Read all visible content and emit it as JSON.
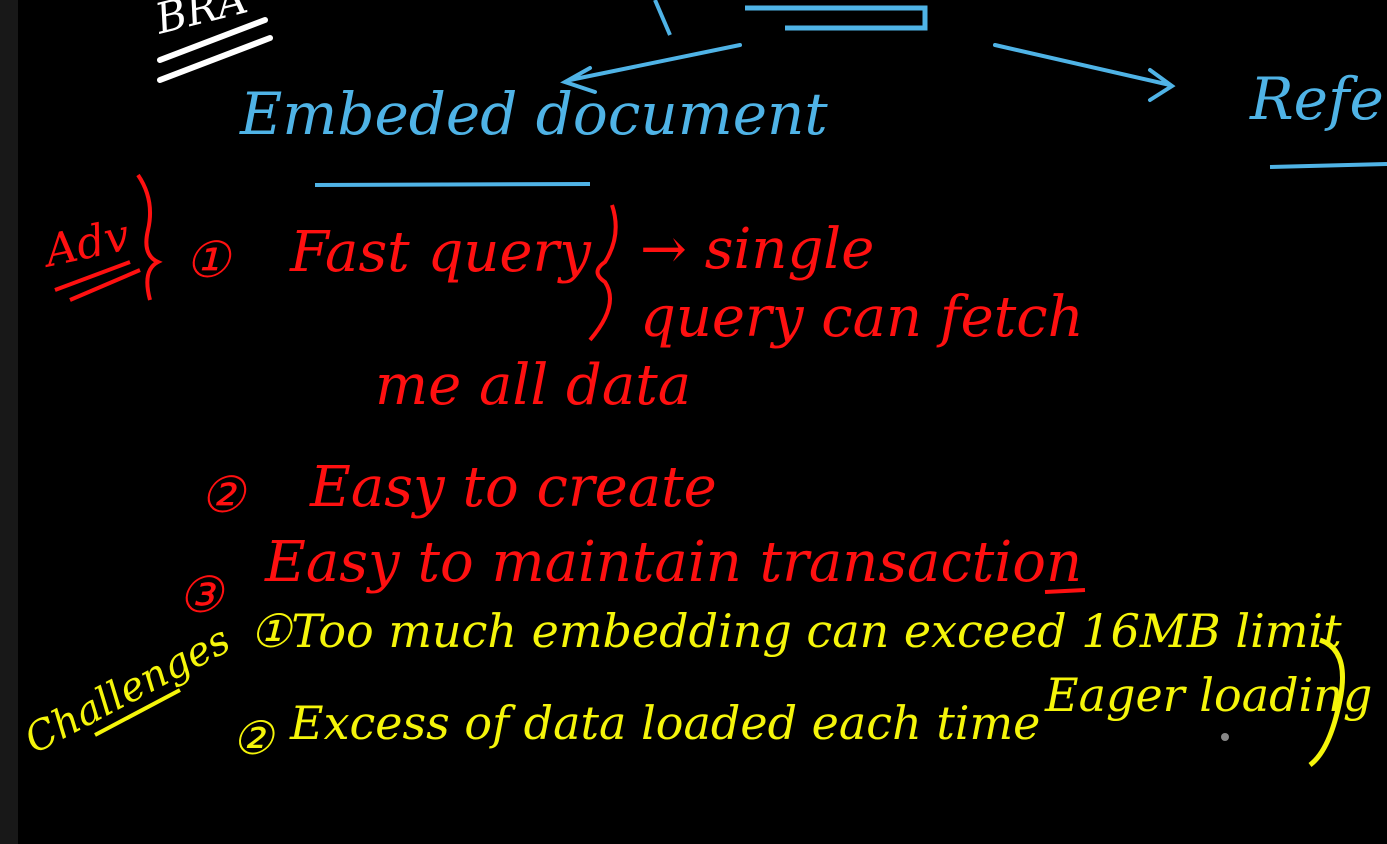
{
  "board": {
    "top_fragment": "BRA",
    "left_branch": "Embeded document",
    "right_branch": "Refer",
    "advantages": {
      "label": "Adv",
      "item1_num": "①",
      "item1_a": "Fast query",
      "item1_b": "→ single",
      "item1_c": "query can fetch",
      "item1_d": "me all data",
      "item2_num": "②",
      "item2": "Easy to create",
      "item3_num": "③",
      "item3": "Easy to maintain transaction"
    },
    "challenges": {
      "label": "Challenges",
      "item1": "①Too much embedding can exceed 16MB limit",
      "item2_num": "②",
      "item2": "Excess of data loaded each time",
      "item2_note": "Eager loading"
    },
    "colors": {
      "background": "#000000",
      "blue": "#4fb3e6",
      "red": "#ff1010",
      "yellow": "#f5f50a"
    }
  }
}
